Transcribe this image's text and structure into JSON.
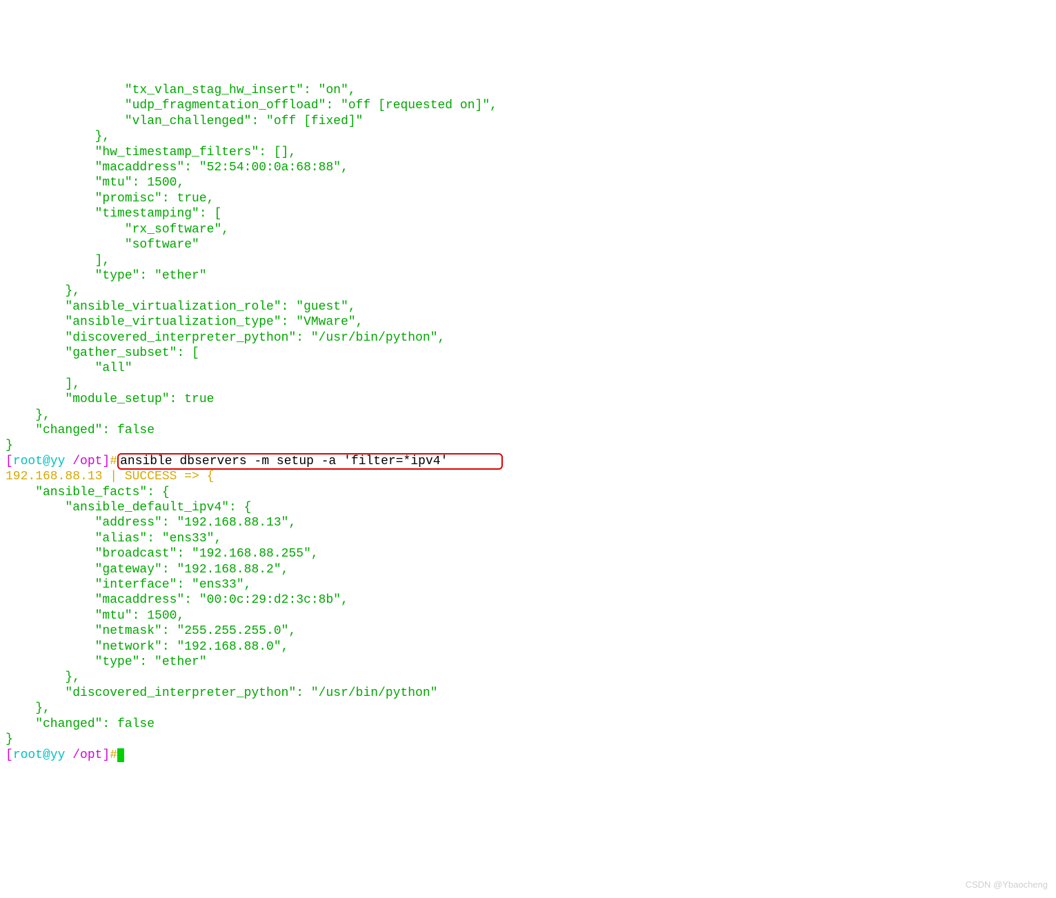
{
  "output1": {
    "l1": "                \"tx_vlan_stag_hw_insert\": \"on\",",
    "l2": "                \"udp_fragmentation_offload\": \"off [requested on]\",",
    "l3": "                \"vlan_challenged\": \"off [fixed]\"",
    "l4": "            },",
    "l5": "            \"hw_timestamp_filters\": [],",
    "l6": "            \"macaddress\": \"52:54:00:0a:68:88\",",
    "l7": "            \"mtu\": 1500,",
    "l8": "            \"promisc\": true,",
    "l9": "            \"timestamping\": [",
    "l10": "                \"rx_software\",",
    "l11": "                \"software\"",
    "l12": "            ],",
    "l13": "            \"type\": \"ether\"",
    "l14": "        },",
    "l15": "        \"ansible_virtualization_role\": \"guest\",",
    "l16": "        \"ansible_virtualization_type\": \"VMware\",",
    "l17": "        \"discovered_interpreter_python\": \"/usr/bin/python\",",
    "l18": "        \"gather_subset\": [",
    "l19": "            \"all\"",
    "l20": "        ],",
    "l21": "        \"module_setup\": true",
    "l22": "    },",
    "l23": "    \"changed\": false",
    "l24": "}"
  },
  "prompt1": {
    "bracket_open": "[",
    "user": "root",
    "at": "@",
    "host": "yy ",
    "path": "/opt",
    "bracket_close": "]",
    "hash": "#",
    "command": "ansible dbservers -m setup -a 'filter=*ipv4'"
  },
  "output2": {
    "status": "192.168.88.13 | SUCCESS => {",
    "l1": "    \"ansible_facts\": {",
    "l2": "        \"ansible_default_ipv4\": {",
    "l3": "            \"address\": \"192.168.88.13\",",
    "l4": "            \"alias\": \"ens33\",",
    "l5": "            \"broadcast\": \"192.168.88.255\",",
    "l6": "            \"gateway\": \"192.168.88.2\",",
    "l7": "            \"interface\": \"ens33\",",
    "l8": "            \"macaddress\": \"00:0c:29:d2:3c:8b\",",
    "l9": "            \"mtu\": 1500,",
    "l10": "            \"netmask\": \"255.255.255.0\",",
    "l11": "            \"network\": \"192.168.88.0\",",
    "l12": "            \"type\": \"ether\"",
    "l13": "        },",
    "l14": "        \"discovered_interpreter_python\": \"/usr/bin/python\"",
    "l15": "    },",
    "l16": "    \"changed\": false",
    "l17": "}"
  },
  "prompt2": {
    "bracket_open": "[",
    "user": "root",
    "at": "@",
    "host": "yy ",
    "path": "/opt",
    "bracket_close": "]",
    "hash": "#"
  },
  "watermark": "CSDN @Ybaocheng"
}
